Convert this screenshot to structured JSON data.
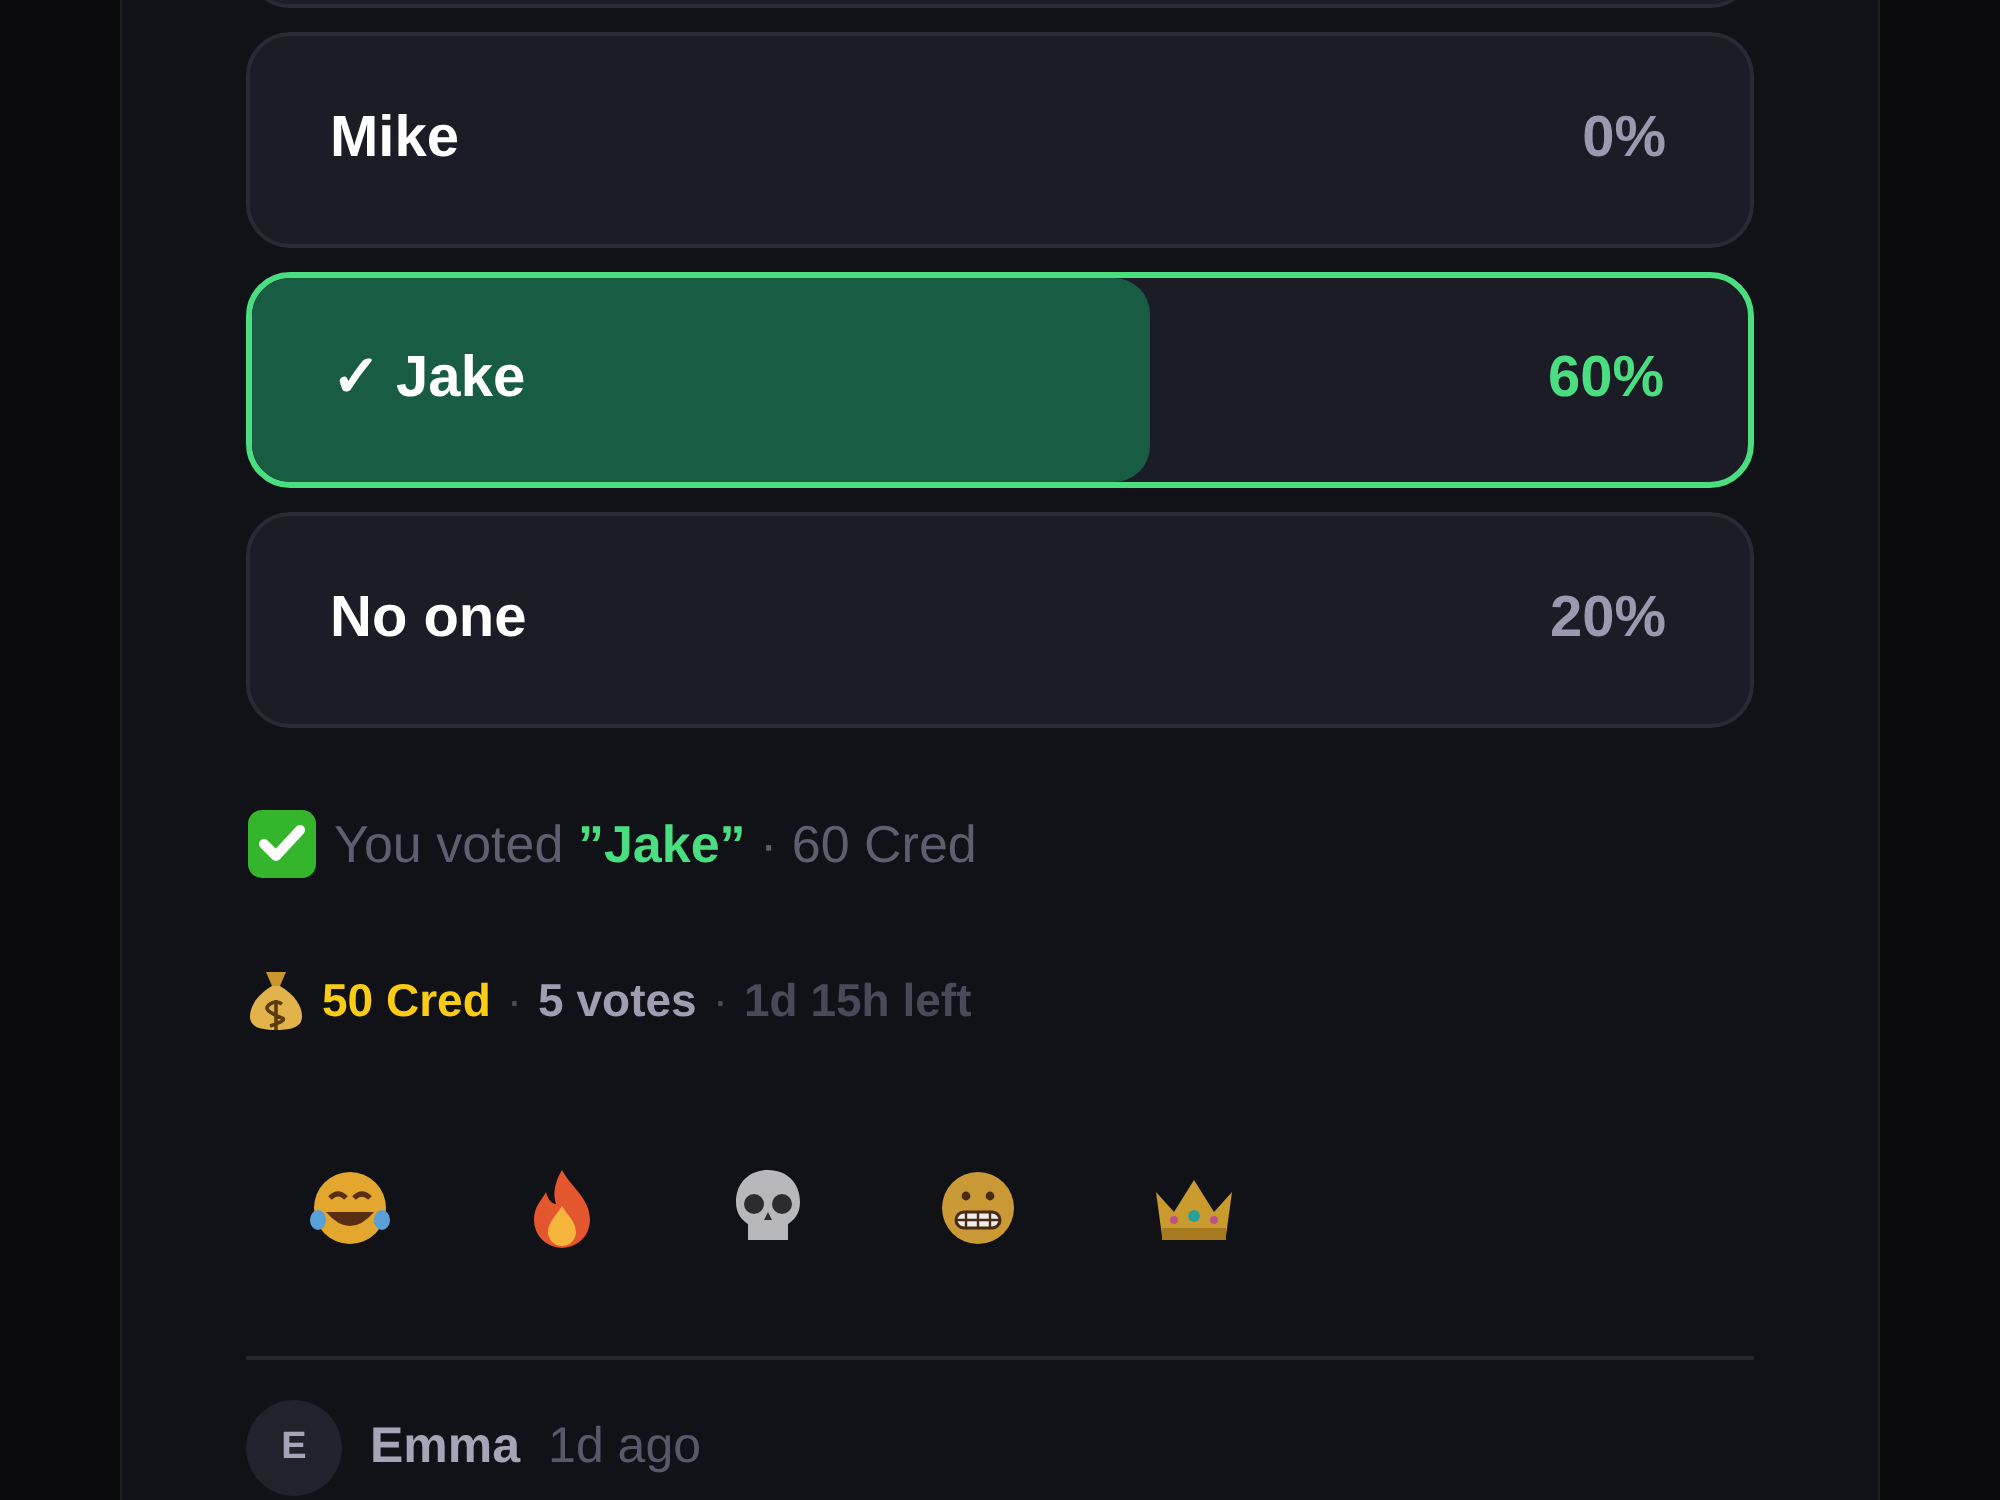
{
  "poll": {
    "options": [
      {
        "label": "Mike",
        "percent": "0%",
        "selected": false
      },
      {
        "label": "Jake",
        "percent": "60%",
        "selected": true,
        "mark": "✓",
        "level": 0.6
      },
      {
        "label": "No one",
        "percent": "20%",
        "selected": false
      }
    ],
    "vote_note": {
      "prefix": "You voted",
      "choice": "”Jake”",
      "separator": "·",
      "suffix": "60 Cred"
    },
    "stats": {
      "prize": "50 Cred",
      "votes": "5 votes",
      "time_left": "1d 15h left",
      "separator": "·"
    },
    "reactions": [
      {
        "kind": "laugh"
      },
      {
        "kind": "fire"
      },
      {
        "kind": "skull"
      },
      {
        "kind": "grimace"
      },
      {
        "kind": "crown"
      }
    ]
  },
  "comment": {
    "avatar": "E",
    "author": "Emma",
    "time": "1d ago"
  }
}
